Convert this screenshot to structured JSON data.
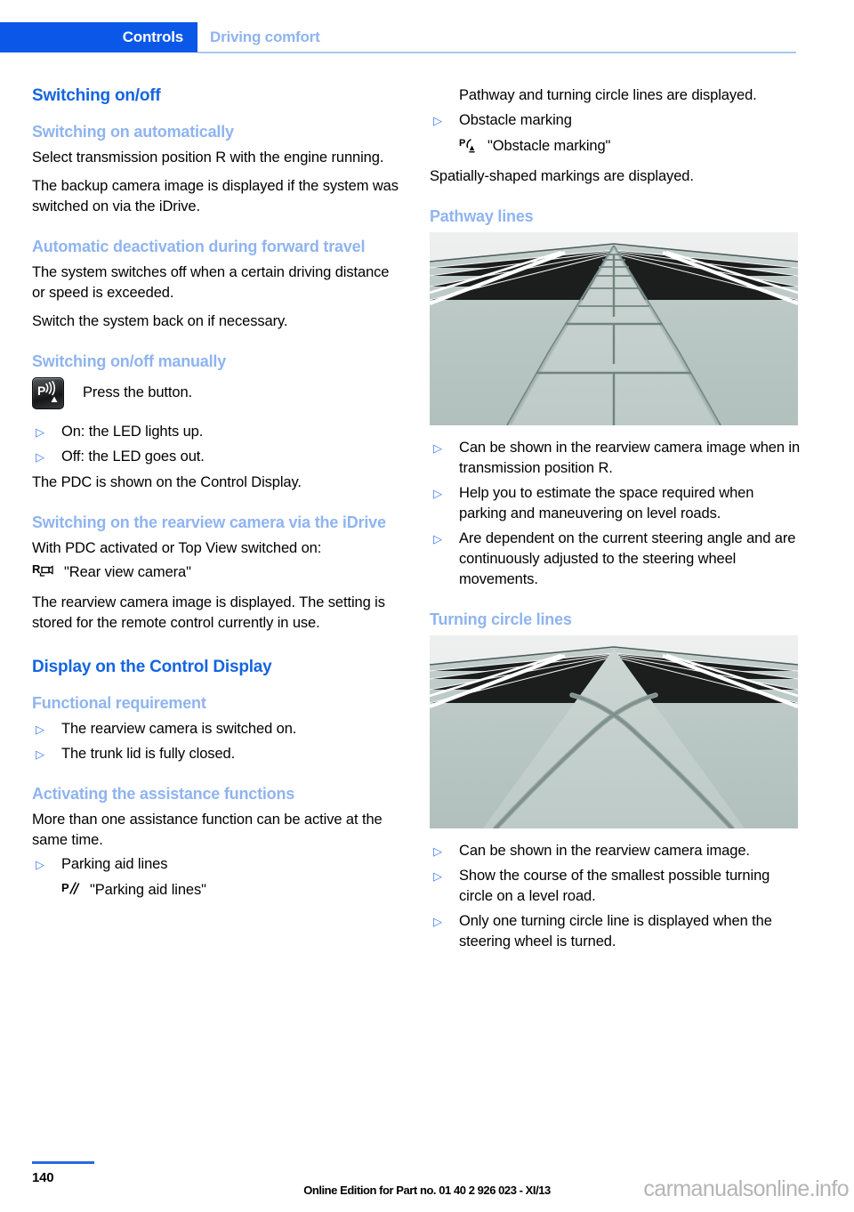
{
  "header": {
    "active_tab": "Controls",
    "section": "Driving comfort",
    "active_color": "#0b57e8",
    "section_color": "#8fb4f0"
  },
  "left_column": {
    "h1_switching": "Switching on/off",
    "h2_auto_on": "Switching on automatically",
    "p_auto_on_1": "Select transmission position R with the engine running.",
    "p_auto_on_2": "The backup camera image is displayed if the system was switched on via the iDrive.",
    "h2_auto_deact": "Automatic deactivation during forward travel",
    "p_auto_deact_1": "The system switches off when a certain driving distance or speed is exceeded.",
    "p_auto_deact_2": "Switch the system back on if necessary.",
    "h2_manual": "Switching on/off manually",
    "pdc_button_label": "Press the button.",
    "pdc_button_icon": "pdc-park-distance-control-button-icon",
    "bullets_led": [
      "On: the LED lights up.",
      "Off: the LED goes out."
    ],
    "p_pdc_display": "The PDC is shown on the Control Display.",
    "h2_rearview_idrive": "Switching on the rearview camera via the iDrive",
    "p_with_pdc": "With PDC activated or Top View switched on:",
    "menu_rear_view": {
      "icon": "rear-view-camera-icon",
      "label": "\"Rear view camera\""
    },
    "p_rearview_stored": "The rearview camera image is displayed. The setting is stored for the remote control currently in use.",
    "h1_display_control": "Display on the Control Display",
    "h2_functional_req": "Functional requirement",
    "bullets_functional": [
      "The rearview camera is switched on.",
      "The trunk lid is fully closed."
    ],
    "h2_activating": "Activating the assistance functions",
    "p_more_than_one": "More than one assistance function can be active at the same time.",
    "bullet_parking_aid": "Parking aid lines",
    "menu_parking_aid": {
      "icon": "parking-aid-lines-icon",
      "label": "\"Parking aid lines\""
    }
  },
  "right_column": {
    "p_pathway_displayed": "Pathway and turning circle lines are displayed.",
    "bullet_obstacle": "Obstacle marking",
    "menu_obstacle": {
      "icon": "obstacle-marking-icon",
      "label": "\"Obstacle marking\""
    },
    "p_spatially_shaped": "Spatially-shaped markings are displayed.",
    "h2_pathway_lines": "Pathway lines",
    "figure_pathway": "pathway-lines-illustration",
    "bullets_pathway": [
      "Can be shown in the rearview camera image when in transmission position R.",
      "Help you to estimate the space required when parking and maneuvering on level roads.",
      "Are dependent on the current steering angle and are continuously adjusted to the steering wheel movements."
    ],
    "h2_turning_circle": "Turning circle lines",
    "figure_turning": "turning-circle-lines-illustration",
    "bullets_turning": [
      "Can be shown in the rearview camera image.",
      "Show the course of the smallest possible turning circle on a level road.",
      "Only one turning circle line is displayed when the steering wheel is turned."
    ]
  },
  "footer": {
    "page_number": "140",
    "edition": "Online Edition for Part no. 01 40 2 926 023 - XI/13",
    "watermark": "carmanualsonline.info"
  },
  "bullet_marker": "▷"
}
